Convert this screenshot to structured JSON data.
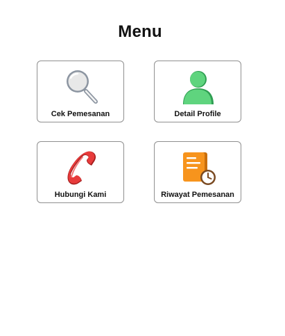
{
  "header": {
    "title": "Menu"
  },
  "menu": {
    "items": [
      {
        "label": "Cek Pemesanan",
        "icon": "search-icon"
      },
      {
        "label": "Detail Profile",
        "icon": "user-icon"
      },
      {
        "label": "Hubungi Kami",
        "icon": "phone-icon"
      },
      {
        "label": "Riwayat Pemesanan",
        "icon": "order-history-icon"
      }
    ]
  },
  "colors": {
    "card_border": "#8f8f8f",
    "search_lens": "#e8e8e8",
    "search_rim": "#8c95a1",
    "user_green": "#5fd47e",
    "user_green_dark": "#2f9e52",
    "phone_red": "#e83b3b",
    "phone_red_dark": "#a51f1f",
    "document_orange": "#f7941d",
    "clock_brown": "#7a4a22"
  }
}
